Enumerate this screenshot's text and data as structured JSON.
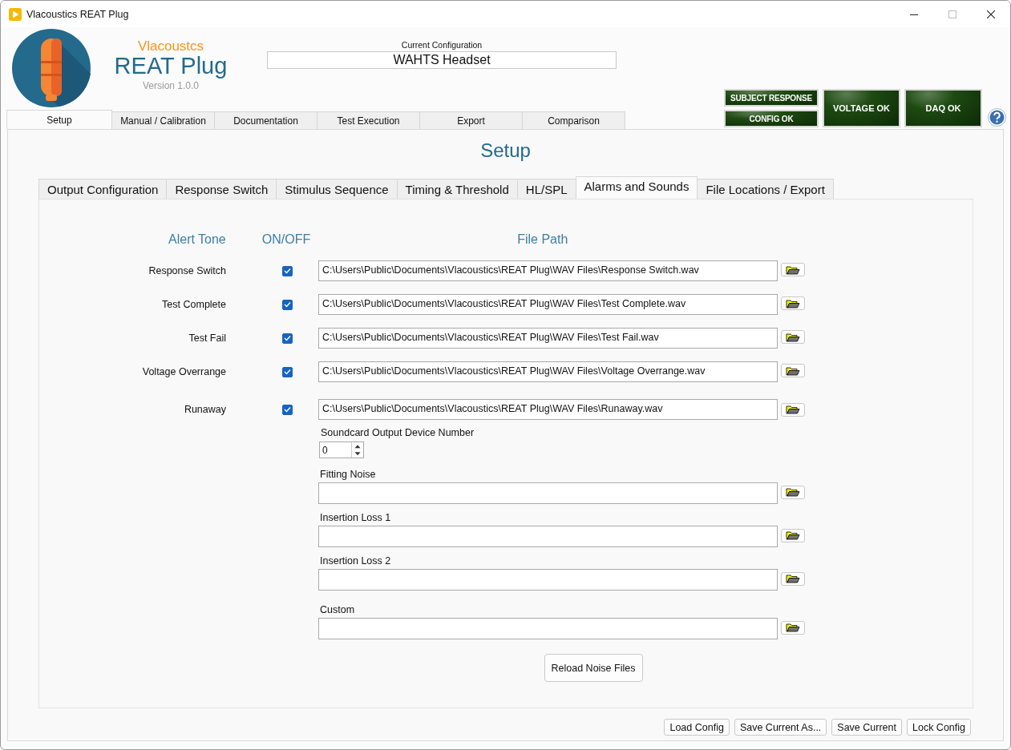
{
  "window": {
    "title": "Vlacoustics REAT Plug"
  },
  "header": {
    "brand": "Vlacoustcs",
    "product": "REAT Plug",
    "version": "Version 1.0.0",
    "config_label": "Current Configuration",
    "config_value": "WAHTS Headset"
  },
  "indicators": [
    {
      "label": "SUBJECT RESPONSE"
    },
    {
      "label": "CONFIG OK"
    },
    {
      "label": "VOLTAGE OK"
    },
    {
      "label": "DAQ OK"
    }
  ],
  "tabs": [
    {
      "label": "Setup",
      "selected": true
    },
    {
      "label": "Manual / Calibration",
      "selected": false
    },
    {
      "label": "Documentation",
      "selected": false
    },
    {
      "label": "Test Execution",
      "selected": false
    },
    {
      "label": "Export",
      "selected": false
    },
    {
      "label": "Comparison",
      "selected": false
    }
  ],
  "page_title": "Setup",
  "subtabs": [
    {
      "label": "Output Configuration",
      "selected": false
    },
    {
      "label": "Response Switch",
      "selected": false
    },
    {
      "label": "Stimulus Sequence",
      "selected": false
    },
    {
      "label": "Timing & Threshold",
      "selected": false
    },
    {
      "label": "HL/SPL",
      "selected": false
    },
    {
      "label": "Alarms and Sounds",
      "selected": true
    },
    {
      "label": "File Locations / Export",
      "selected": false
    }
  ],
  "alerts": {
    "columns": [
      "Alert Tone",
      "ON/OFF",
      "File Path"
    ],
    "rows": [
      {
        "name": "Response Switch",
        "checked": true,
        "path": "C:\\Users\\Public\\Documents\\Vlacoustics\\REAT Plug\\WAV Files\\Response Switch.wav"
      },
      {
        "name": "Test Complete",
        "checked": true,
        "path": "C:\\Users\\Public\\Documents\\Vlacoustics\\REAT Plug\\WAV Files\\Test Complete.wav"
      },
      {
        "name": "Test Fail",
        "checked": true,
        "path": "C:\\Users\\Public\\Documents\\Vlacoustics\\REAT Plug\\WAV Files\\Test Fail.wav"
      },
      {
        "name": "Voltage Overrange",
        "checked": true,
        "path": "C:\\Users\\Public\\Documents\\Vlacoustics\\REAT Plug\\WAV Files\\Voltage Overrange.wav"
      },
      {
        "name": "Runaway",
        "checked": true,
        "path": "C:\\Users\\Public\\Documents\\Vlacoustics\\REAT Plug\\WAV Files\\Runaway.wav"
      }
    ]
  },
  "soundcard": {
    "label": "Soundcard Output Device Number",
    "value": "0"
  },
  "noise_files": [
    {
      "label": "Fitting Noise"
    },
    {
      "label": "Insertion Loss 1"
    },
    {
      "label": "Insertion Loss 2"
    },
    {
      "label": "Custom"
    }
  ],
  "reload_button": "Reload Noise Files",
  "footer_buttons": [
    "Load Config",
    "Save Current As...",
    "Save Current",
    "Lock Config"
  ]
}
